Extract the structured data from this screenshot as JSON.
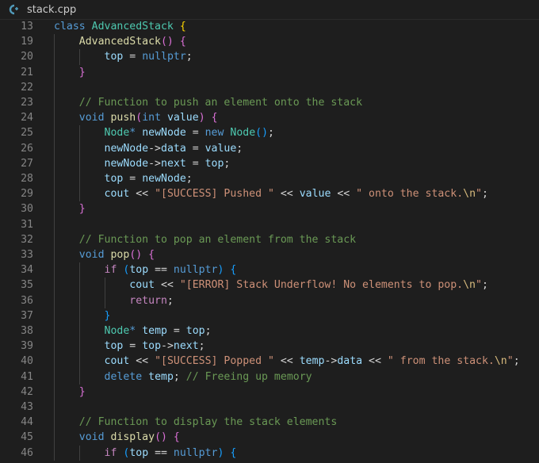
{
  "tab": {
    "filename": "stack.cpp",
    "icon": "cpp-file-icon"
  },
  "lines": [
    {
      "n": "13",
      "segs": [
        [
          "kw",
          "class"
        ],
        [
          "p",
          " "
        ],
        [
          "cl",
          "AdvancedStack"
        ],
        [
          "p",
          " "
        ],
        [
          "br1",
          "{"
        ]
      ]
    },
    {
      "n": "19",
      "segs": [
        [
          "p",
          "    "
        ],
        [
          "fn",
          "AdvancedStack"
        ],
        [
          "br2",
          "()"
        ],
        [
          "p",
          " "
        ],
        [
          "br2",
          "{"
        ]
      ]
    },
    {
      "n": "20",
      "segs": [
        [
          "p",
          "        "
        ],
        [
          "vr",
          "top"
        ],
        [
          "p",
          " = "
        ],
        [
          "kw",
          "nullptr"
        ],
        [
          "p",
          ";"
        ]
      ]
    },
    {
      "n": "21",
      "segs": [
        [
          "p",
          "    "
        ],
        [
          "br2",
          "}"
        ]
      ]
    },
    {
      "n": "22",
      "segs": []
    },
    {
      "n": "23",
      "segs": [
        [
          "p",
          "    "
        ],
        [
          "cm",
          "// Function to push an element onto the stack"
        ]
      ]
    },
    {
      "n": "24",
      "segs": [
        [
          "p",
          "    "
        ],
        [
          "kw",
          "void"
        ],
        [
          "p",
          " "
        ],
        [
          "fn",
          "push"
        ],
        [
          "br2",
          "("
        ],
        [
          "kw",
          "int"
        ],
        [
          "p",
          " "
        ],
        [
          "vr",
          "value"
        ],
        [
          "br2",
          ")"
        ],
        [
          "p",
          " "
        ],
        [
          "br2",
          "{"
        ]
      ]
    },
    {
      "n": "25",
      "segs": [
        [
          "p",
          "        "
        ],
        [
          "cl",
          "Node"
        ],
        [
          "kw",
          "*"
        ],
        [
          "p",
          " "
        ],
        [
          "vr",
          "newNode"
        ],
        [
          "p",
          " = "
        ],
        [
          "kw",
          "new"
        ],
        [
          "p",
          " "
        ],
        [
          "cl",
          "Node"
        ],
        [
          "br3",
          "()"
        ],
        [
          "p",
          ";"
        ]
      ]
    },
    {
      "n": "26",
      "segs": [
        [
          "p",
          "        "
        ],
        [
          "vr",
          "newNode"
        ],
        [
          "p",
          "->"
        ],
        [
          "vr",
          "data"
        ],
        [
          "p",
          " = "
        ],
        [
          "vr",
          "value"
        ],
        [
          "p",
          ";"
        ]
      ]
    },
    {
      "n": "27",
      "segs": [
        [
          "p",
          "        "
        ],
        [
          "vr",
          "newNode"
        ],
        [
          "p",
          "->"
        ],
        [
          "vr",
          "next"
        ],
        [
          "p",
          " = "
        ],
        [
          "vr",
          "top"
        ],
        [
          "p",
          ";"
        ]
      ]
    },
    {
      "n": "28",
      "segs": [
        [
          "p",
          "        "
        ],
        [
          "vr",
          "top"
        ],
        [
          "p",
          " = "
        ],
        [
          "vr",
          "newNode"
        ],
        [
          "p",
          ";"
        ]
      ]
    },
    {
      "n": "29",
      "segs": [
        [
          "p",
          "        "
        ],
        [
          "vr",
          "cout"
        ],
        [
          "p",
          " << "
        ],
        [
          "str",
          "\"[SUCCESS] Pushed \""
        ],
        [
          "p",
          " << "
        ],
        [
          "vr",
          "value"
        ],
        [
          "p",
          " << "
        ],
        [
          "str",
          "\" onto the stack."
        ],
        [
          "esc",
          "\\n"
        ],
        [
          "str",
          "\""
        ],
        [
          "p",
          ";"
        ]
      ]
    },
    {
      "n": "30",
      "segs": [
        [
          "p",
          "    "
        ],
        [
          "br2",
          "}"
        ]
      ]
    },
    {
      "n": "31",
      "segs": []
    },
    {
      "n": "32",
      "segs": [
        [
          "p",
          "    "
        ],
        [
          "cm",
          "// Function to pop an element from the stack"
        ]
      ]
    },
    {
      "n": "33",
      "segs": [
        [
          "p",
          "    "
        ],
        [
          "kw",
          "void"
        ],
        [
          "p",
          " "
        ],
        [
          "fn",
          "pop"
        ],
        [
          "br2",
          "()"
        ],
        [
          "p",
          " "
        ],
        [
          "br2",
          "{"
        ]
      ]
    },
    {
      "n": "34",
      "segs": [
        [
          "p",
          "        "
        ],
        [
          "ctl",
          "if"
        ],
        [
          "p",
          " "
        ],
        [
          "br3",
          "("
        ],
        [
          "vr",
          "top"
        ],
        [
          "p",
          " == "
        ],
        [
          "kw",
          "nullptr"
        ],
        [
          "br3",
          ")"
        ],
        [
          "p",
          " "
        ],
        [
          "br3",
          "{"
        ]
      ]
    },
    {
      "n": "35",
      "segs": [
        [
          "p",
          "            "
        ],
        [
          "vr",
          "cout"
        ],
        [
          "p",
          " << "
        ],
        [
          "str",
          "\"[ERROR] Stack Underflow! No elements to pop."
        ],
        [
          "esc",
          "\\n"
        ],
        [
          "str",
          "\""
        ],
        [
          "p",
          ";"
        ]
      ]
    },
    {
      "n": "36",
      "segs": [
        [
          "p",
          "            "
        ],
        [
          "ctl",
          "return"
        ],
        [
          "p",
          ";"
        ]
      ]
    },
    {
      "n": "37",
      "segs": [
        [
          "p",
          "        "
        ],
        [
          "br3",
          "}"
        ]
      ]
    },
    {
      "n": "38",
      "segs": [
        [
          "p",
          "        "
        ],
        [
          "cl",
          "Node"
        ],
        [
          "kw",
          "*"
        ],
        [
          "p",
          " "
        ],
        [
          "vr",
          "temp"
        ],
        [
          "p",
          " = "
        ],
        [
          "vr",
          "top"
        ],
        [
          "p",
          ";"
        ]
      ]
    },
    {
      "n": "39",
      "segs": [
        [
          "p",
          "        "
        ],
        [
          "vr",
          "top"
        ],
        [
          "p",
          " = "
        ],
        [
          "vr",
          "top"
        ],
        [
          "p",
          "->"
        ],
        [
          "vr",
          "next"
        ],
        [
          "p",
          ";"
        ]
      ]
    },
    {
      "n": "40",
      "segs": [
        [
          "p",
          "        "
        ],
        [
          "vr",
          "cout"
        ],
        [
          "p",
          " << "
        ],
        [
          "str",
          "\"[SUCCESS] Popped \""
        ],
        [
          "p",
          " << "
        ],
        [
          "vr",
          "temp"
        ],
        [
          "p",
          "->"
        ],
        [
          "vr",
          "data"
        ],
        [
          "p",
          " << "
        ],
        [
          "str",
          "\" from the stack."
        ],
        [
          "esc",
          "\\n"
        ],
        [
          "str",
          "\""
        ],
        [
          "p",
          ";"
        ]
      ]
    },
    {
      "n": "41",
      "segs": [
        [
          "p",
          "        "
        ],
        [
          "kw",
          "delete"
        ],
        [
          "p",
          " "
        ],
        [
          "vr",
          "temp"
        ],
        [
          "p",
          "; "
        ],
        [
          "cm",
          "// Freeing up memory"
        ]
      ]
    },
    {
      "n": "42",
      "segs": [
        [
          "p",
          "    "
        ],
        [
          "br2",
          "}"
        ]
      ]
    },
    {
      "n": "43",
      "segs": []
    },
    {
      "n": "44",
      "segs": [
        [
          "p",
          "    "
        ],
        [
          "cm",
          "// Function to display the stack elements"
        ]
      ]
    },
    {
      "n": "45",
      "segs": [
        [
          "p",
          "    "
        ],
        [
          "kw",
          "void"
        ],
        [
          "p",
          " "
        ],
        [
          "fn",
          "display"
        ],
        [
          "br2",
          "()"
        ],
        [
          "p",
          " "
        ],
        [
          "br2",
          "{"
        ]
      ]
    },
    {
      "n": "46",
      "segs": [
        [
          "p",
          "        "
        ],
        [
          "ctl",
          "if"
        ],
        [
          "p",
          " "
        ],
        [
          "br3",
          "("
        ],
        [
          "vr",
          "top"
        ],
        [
          "p",
          " == "
        ],
        [
          "kw",
          "nullptr"
        ],
        [
          "br3",
          ")"
        ],
        [
          "p",
          " "
        ],
        [
          "br3",
          "{"
        ]
      ]
    }
  ]
}
